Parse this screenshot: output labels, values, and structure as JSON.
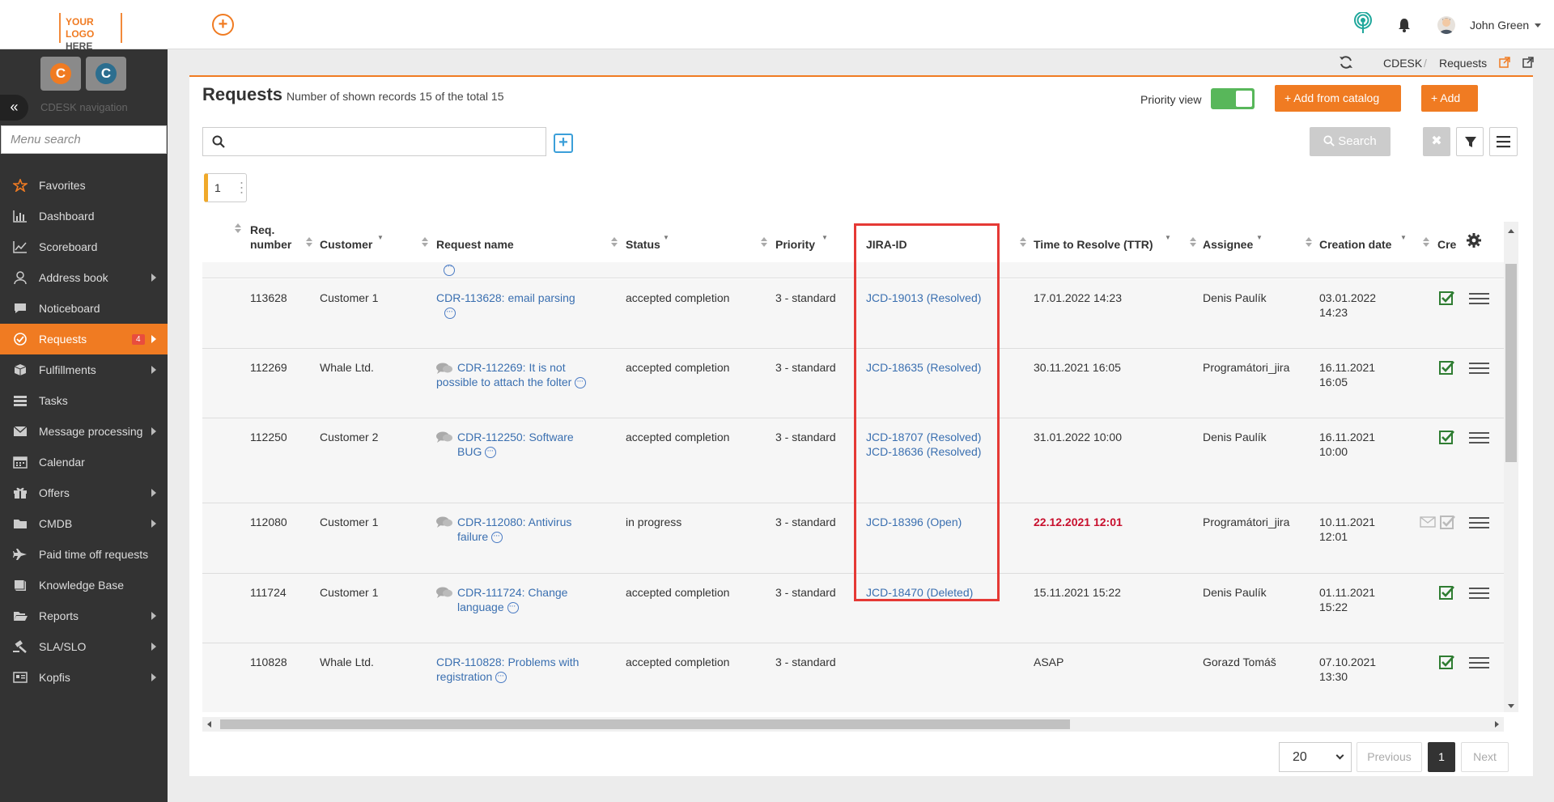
{
  "header": {
    "logo_line1": "YOUR LOGO",
    "logo_line2": "HERE",
    "user_name": "John Green"
  },
  "sidebar": {
    "nav_caption": "CDESK navigation",
    "menu_search_placeholder": "Menu search",
    "items": [
      {
        "label": "Favorites",
        "icon": "star-icon",
        "arrow": false
      },
      {
        "label": "Dashboard",
        "icon": "bar-chart-icon",
        "arrow": false
      },
      {
        "label": "Scoreboard",
        "icon": "line-chart-icon",
        "arrow": false
      },
      {
        "label": "Address book",
        "icon": "user-icon",
        "arrow": true
      },
      {
        "label": "Noticeboard",
        "icon": "chat-icon",
        "arrow": false
      },
      {
        "label": "Requests",
        "icon": "check-circle-icon",
        "arrow": true,
        "badge": "4",
        "active": true
      },
      {
        "label": "Fulfillments",
        "icon": "cube-icon",
        "arrow": true
      },
      {
        "label": "Tasks",
        "icon": "tasks-icon",
        "arrow": false
      },
      {
        "label": "Message processing",
        "icon": "envelope-icon",
        "arrow": true
      },
      {
        "label": "Calendar",
        "icon": "calendar-icon",
        "arrow": false
      },
      {
        "label": "Offers",
        "icon": "gift-icon",
        "arrow": true
      },
      {
        "label": "CMDB",
        "icon": "folder-icon",
        "arrow": true
      },
      {
        "label": "Paid time off requests",
        "icon": "plane-icon",
        "arrow": false
      },
      {
        "label": "Knowledge Base",
        "icon": "book-icon",
        "arrow": false
      },
      {
        "label": "Reports",
        "icon": "folder-open-icon",
        "arrow": true
      },
      {
        "label": "SLA/SLO",
        "icon": "gavel-icon",
        "arrow": true
      },
      {
        "label": "Kopfis",
        "icon": "id-card-icon",
        "arrow": true
      }
    ]
  },
  "breadcrumb": {
    "root": "CDESK",
    "separator": "/",
    "current": "Requests"
  },
  "page": {
    "title": "Requests",
    "subtitle": "Number of shown records 15 of the total 15",
    "priority_view_label": "Priority view",
    "priority_view_on": true,
    "add_from_catalog": "+ Add from catalog",
    "add": "+ Add",
    "search_button": "Search",
    "page_chip": "1"
  },
  "table": {
    "headers": {
      "req_number": "Req. number",
      "customer": "Customer",
      "request_name": "Request name",
      "status": "Status",
      "priority": "Priority",
      "jira_id": "JIRA-ID",
      "ttr": "Time to Resolve (TTR)",
      "assignee": "Assignee",
      "creation_date": "Creation date",
      "cre": "Cre"
    },
    "rows": [
      {
        "number": "113628",
        "customer": "Customer 1",
        "name": "CDR-113628: email parsing",
        "status": "accepted completion",
        "priority": "3 - standard",
        "jira1": "JCD-19013 (Resolved)",
        "jira2": "",
        "ttr": "17.01.2022 14:23",
        "ttr_overdue": false,
        "assignee": "Denis Paulík",
        "created_date": "03.01.2022",
        "created_time": "14:23"
      },
      {
        "number": "112269",
        "customer": "Whale Ltd.",
        "name": "CDR-112269: It is not possible to attach the folter",
        "status": "accepted completion",
        "priority": "3 - standard",
        "jira1": "JCD-18635 (Resolved)",
        "jira2": "",
        "ttr": "30.11.2021 16:05",
        "ttr_overdue": false,
        "assignee": "Programátori_jira",
        "created_date": "16.11.2021",
        "created_time": "16:05"
      },
      {
        "number": "112250",
        "customer": "Customer 2",
        "name": "CDR-112250: Software BUG",
        "status": "accepted completion",
        "priority": "3 - standard",
        "jira1": "JCD-18707 (Resolved)",
        "jira2": "JCD-18636 (Resolved)",
        "ttr": "31.01.2022 10:00",
        "ttr_overdue": false,
        "assignee": "Denis Paulík",
        "created_date": "16.11.2021",
        "created_time": "10:00"
      },
      {
        "number": "112080",
        "customer": "Customer 1",
        "name": "CDR-112080: Antivirus failure",
        "status": "in progress",
        "priority": "3 - standard",
        "jira1": "JCD-18396 (Open)",
        "jira2": "",
        "ttr": "22.12.2021 12:01",
        "ttr_overdue": true,
        "assignee": "Programátori_jira",
        "created_date": "10.11.2021",
        "created_time": "12:01"
      },
      {
        "number": "111724",
        "customer": "Customer 1",
        "name": "CDR-111724: Change language",
        "status": "accepted completion",
        "priority": "3 - standard",
        "jira1": "JCD-18470 (Deleted)",
        "jira2": "",
        "ttr": "15.11.2021 15:22",
        "ttr_overdue": false,
        "assignee": "Denis Paulík",
        "created_date": "01.11.2021",
        "created_time": "15:22"
      },
      {
        "number": "110828",
        "customer": "Whale Ltd.",
        "name": "CDR-110828: Problems with registration",
        "status": "accepted completion",
        "priority": "3 - standard",
        "jira1": "",
        "jira2": "",
        "ttr": "ASAP",
        "ttr_overdue": false,
        "assignee": "Gorazd Tomáš",
        "created_date": "07.10.2021",
        "created_time": "13:30"
      }
    ]
  },
  "pagination": {
    "page_size": "20",
    "previous": "Previous",
    "current": "1",
    "next": "Next"
  },
  "colors": {
    "accent": "#f07b22",
    "sidebar_bg": "#333333",
    "link": "#3a6fb0",
    "overdue": "#c8102e",
    "highlight": "#e53935",
    "toggle_on": "#58b75a"
  }
}
